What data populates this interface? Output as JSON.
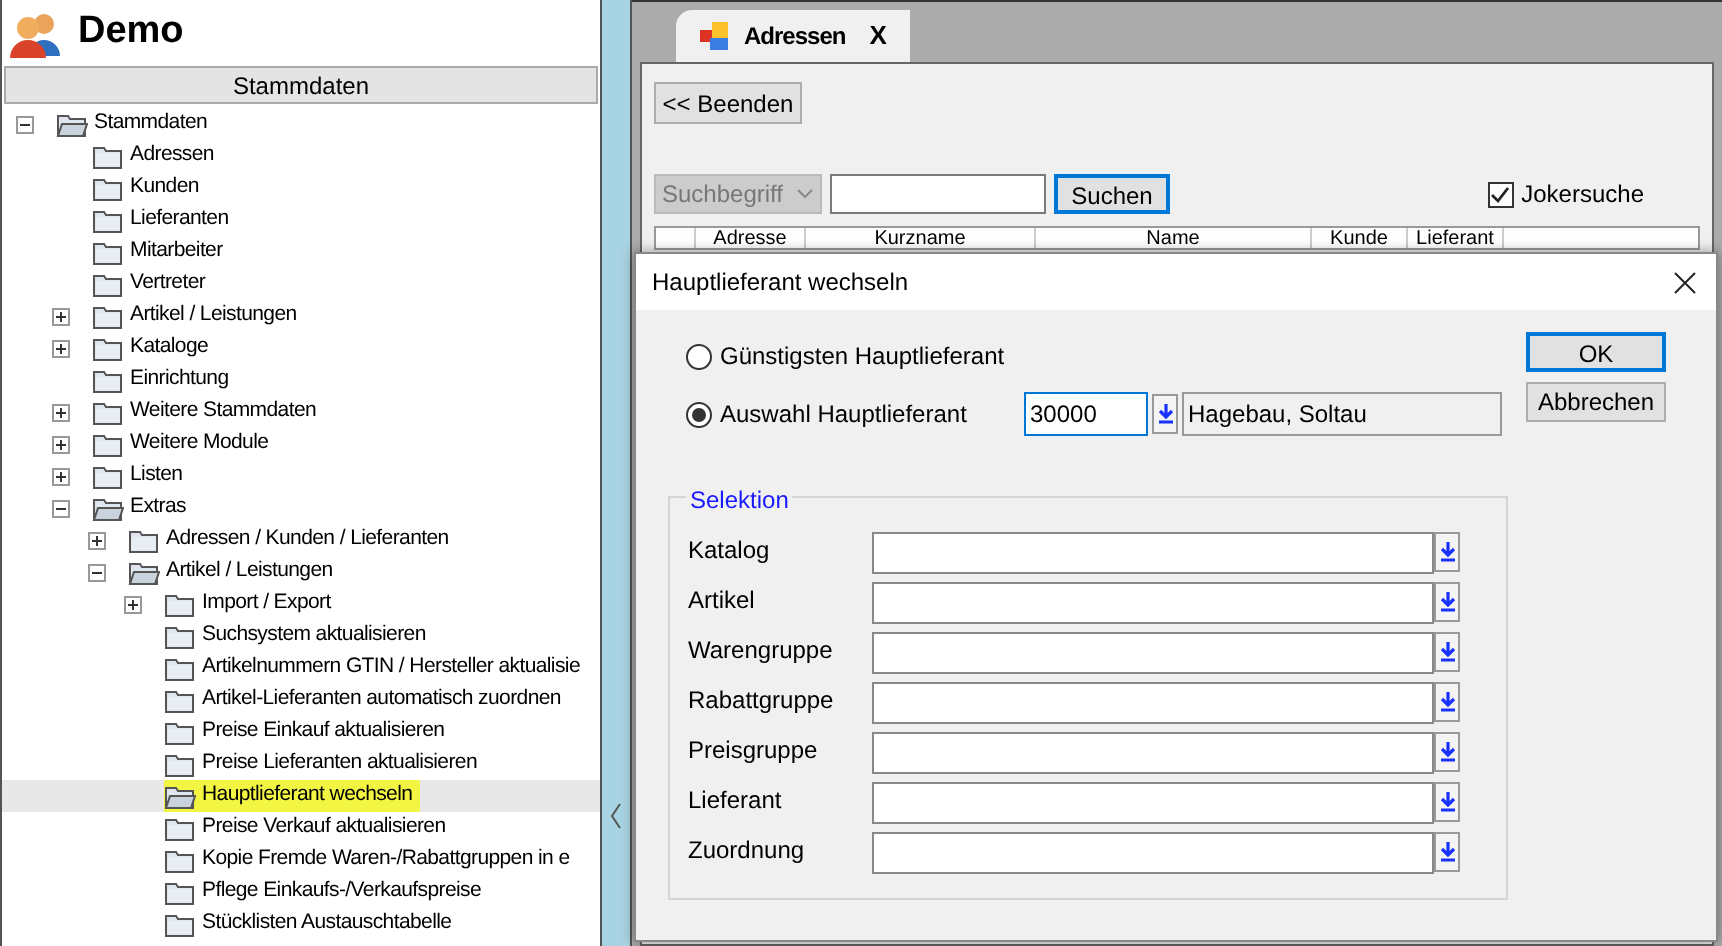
{
  "app": {
    "title": "Demo"
  },
  "sidebar": {
    "header": "Stammdaten",
    "tree": [
      {
        "label": "Stammdaten",
        "expanded": true,
        "selected": false,
        "children": [
          {
            "label": "Adressen",
            "selected": false
          },
          {
            "label": "Kunden",
            "selected": false
          },
          {
            "label": "Lieferanten",
            "selected": false
          },
          {
            "label": "Mitarbeiter",
            "selected": false
          },
          {
            "label": "Vertreter",
            "selected": false
          },
          {
            "label": "Artikel / Leistungen",
            "expanded": false,
            "selected": false
          },
          {
            "label": "Kataloge",
            "expanded": false,
            "selected": false
          },
          {
            "label": "Einrichtung",
            "selected": false
          },
          {
            "label": "Weitere Stammdaten",
            "expanded": false,
            "selected": false
          },
          {
            "label": "Weitere Module",
            "expanded": false,
            "selected": false
          },
          {
            "label": "Listen",
            "expanded": false,
            "selected": false
          },
          {
            "label": "Extras",
            "expanded": true,
            "selected": false,
            "children": [
              {
                "label": "Adressen / Kunden / Lieferanten",
                "expanded": false,
                "selected": false
              },
              {
                "label": "Artikel / Leistungen",
                "expanded": true,
                "selected": false,
                "children": [
                  {
                    "label": "Import / Export",
                    "expanded": false,
                    "selected": false
                  },
                  {
                    "label": "Suchsystem aktualisieren",
                    "selected": false
                  },
                  {
                    "label": "Artikelnummern GTIN / Hersteller aktualisie",
                    "selected": false
                  },
                  {
                    "label": "Artikel-Lieferanten automatisch zuordnen",
                    "selected": false
                  },
                  {
                    "label": "Preise Einkauf aktualisieren",
                    "selected": false
                  },
                  {
                    "label": "Preise Lieferanten aktualisieren",
                    "selected": false
                  },
                  {
                    "label": "Hauptlieferant wechseln",
                    "selected": true
                  },
                  {
                    "label": "Preise Verkauf aktualisieren",
                    "selected": false
                  },
                  {
                    "label": "Kopie Fremde Waren-/Rabattgruppen in e",
                    "selected": false
                  },
                  {
                    "label": "Pflege Einkaufs-/Verkaufspreise",
                    "selected": false
                  },
                  {
                    "label": "Stücklisten Austauschtabelle",
                    "selected": false
                  }
                ]
              }
            ]
          }
        ]
      }
    ]
  },
  "tabs": [
    {
      "label": "Adressen",
      "close": "X",
      "selected": true
    }
  ],
  "toolbar": {
    "back_button": "<< Beenden"
  },
  "search": {
    "field_select": "Suchbegriff",
    "button": "Suchen",
    "wildcard": {
      "label": "Jokersuche",
      "checked": true
    }
  },
  "table": {
    "columns": [
      "Adresse",
      "Kurzname",
      "Name",
      "Kunde",
      "Lieferant"
    ]
  },
  "dialog": {
    "title": "Hauptlieferant wechseln",
    "options": [
      {
        "label": "Günstigsten Hauptlieferant",
        "selected": false
      },
      {
        "label": "Auswahl Hauptlieferant",
        "selected": true
      }
    ],
    "supplier_number": "30000",
    "supplier_name": "Hagebau, Soltau",
    "buttons": [
      {
        "label": "OK",
        "default": true
      },
      {
        "label": "Abbrechen",
        "default": false
      }
    ],
    "selection": {
      "title": "Selektion",
      "fields": [
        {
          "label": "Katalog"
        },
        {
          "label": "Artikel"
        },
        {
          "label": "Warengruppe"
        },
        {
          "label": "Rabattgruppe"
        },
        {
          "label": "Preisgruppe"
        },
        {
          "label": "Lieferant"
        },
        {
          "label": "Zuordnung"
        }
      ]
    }
  }
}
